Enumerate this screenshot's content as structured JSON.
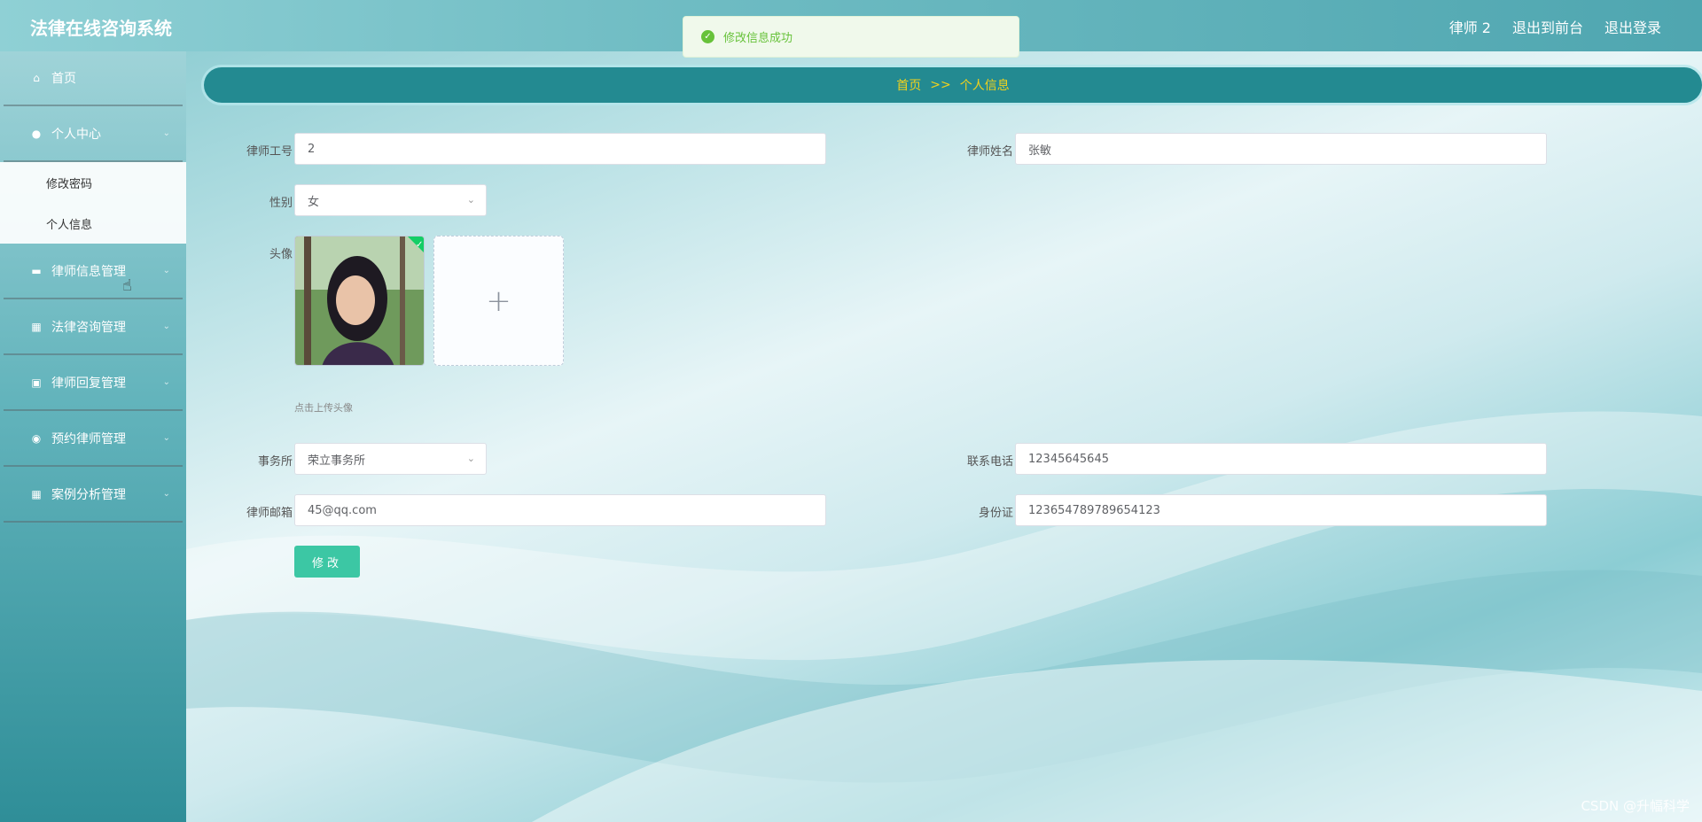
{
  "header": {
    "title": "法律在线咨询系统",
    "links": [
      "律师 2",
      "退出到前台",
      "退出登录"
    ]
  },
  "toast": {
    "message": "修改信息成功"
  },
  "sidebar": {
    "items": [
      {
        "label": "首页",
        "icon": "home-icon"
      },
      {
        "label": "个人中心",
        "icon": "user-icon"
      },
      {
        "label": "律师信息管理",
        "icon": "ticket-icon"
      },
      {
        "label": "法律咨询管理",
        "icon": "grid-icon"
      },
      {
        "label": "律师回复管理",
        "icon": "briefcase-icon"
      },
      {
        "label": "预约律师管理",
        "icon": "location-icon"
      },
      {
        "label": "案例分析管理",
        "icon": "grid-icon"
      }
    ],
    "submenu": [
      "修改密码",
      "个人信息"
    ]
  },
  "breadcrumb": {
    "home": "首页",
    "sep": ">>",
    "current": "个人信息"
  },
  "form": {
    "lawyer_no_label": "律师工号",
    "lawyer_no": "2",
    "name_label": "律师姓名",
    "name": "张敏",
    "gender_label": "性别",
    "gender": "女",
    "avatar_label": "头像",
    "upload_tip": "点击上传头像",
    "firm_label": "事务所",
    "firm": "荣立事务所",
    "phone_label": "联系电话",
    "phone": "12345645645",
    "email_label": "律师邮箱",
    "email": "45@qq.com",
    "id_label": "身份证",
    "id_card": "123654789789654123",
    "submit": "修改"
  },
  "watermark": "CSDN @升幅科学"
}
